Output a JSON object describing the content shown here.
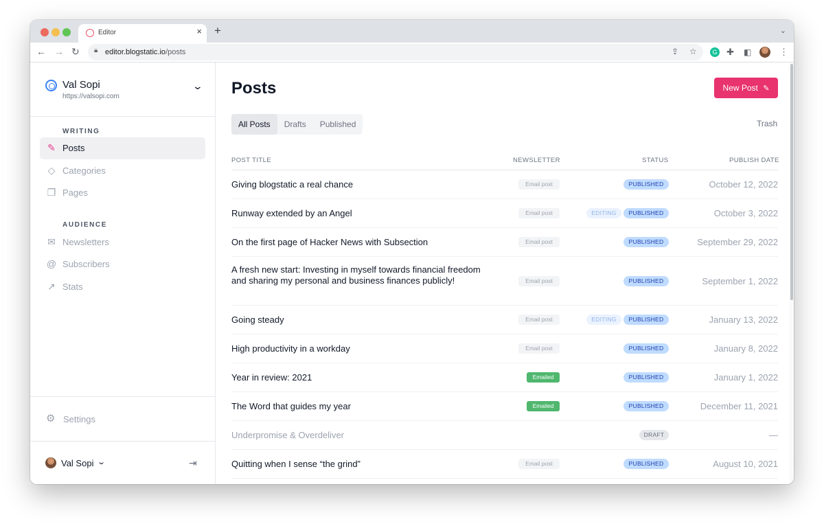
{
  "browser": {
    "tab_title": "Editor",
    "url_domain": "editor.blogstatic.io",
    "url_path": "/posts"
  },
  "site": {
    "name": "Val Sopi",
    "url": "https://valsopi.com"
  },
  "sidebar": {
    "writing_heading": "WRITING",
    "writing_items": [
      {
        "label": "Posts",
        "icon": "edit-icon",
        "active": true
      },
      {
        "label": "Categories",
        "icon": "tag-icon",
        "active": false
      },
      {
        "label": "Pages",
        "icon": "pages-icon",
        "active": false
      }
    ],
    "audience_heading": "AUDIENCE",
    "audience_items": [
      {
        "label": "Newsletters",
        "icon": "mail-icon"
      },
      {
        "label": "Subscribers",
        "icon": "at-icon"
      },
      {
        "label": "Stats",
        "icon": "trend-icon"
      }
    ],
    "settings_label": "Settings",
    "user_name": "Val Sopi"
  },
  "main": {
    "title": "Posts",
    "new_post_label": "New Post",
    "filters": [
      "All Posts",
      "Drafts",
      "Published"
    ],
    "active_filter": "All Posts",
    "trash_label": "Trash",
    "columns": [
      "POST TITLE",
      "NEWSLETTER",
      "STATUS",
      "PUBLISH DATE"
    ],
    "posts": [
      {
        "title": "Giving blogstatic a real chance",
        "newsletter": "Email post",
        "editing": "",
        "status": "PUBLISHED",
        "date": "October 12, 2022"
      },
      {
        "title": "Runway extended by an Angel",
        "newsletter": "Email post",
        "editing": "EDITING",
        "status": "PUBLISHED",
        "date": "October 3, 2022"
      },
      {
        "title": "On the first page of Hacker News with Subsection",
        "newsletter": "Email post",
        "editing": "",
        "status": "PUBLISHED",
        "date": "September 29, 2022"
      },
      {
        "title": "A fresh new start: Investing in myself towards financial freedom and sharing my personal and business finances publicly!",
        "newsletter": "Email post",
        "editing": "",
        "status": "PUBLISHED",
        "date": "September 1, 2022"
      },
      {
        "title": "Going steady",
        "newsletter": "Email post",
        "editing": "EDITING",
        "status": "PUBLISHED",
        "date": "January 13, 2022"
      },
      {
        "title": "High productivity in a workday",
        "newsletter": "Email post",
        "editing": "",
        "status": "PUBLISHED",
        "date": "January 8, 2022"
      },
      {
        "title": "Year in review: 2021",
        "newsletter": "Emailed",
        "editing": "",
        "status": "PUBLISHED",
        "date": "January 1, 2022"
      },
      {
        "title": "The Word that guides my year",
        "newsletter": "Emailed",
        "editing": "",
        "status": "PUBLISHED",
        "date": "December 11, 2021"
      },
      {
        "title": "Underpromise & Overdeliver",
        "newsletter": "",
        "editing": "",
        "status": "DRAFT",
        "date": "—"
      },
      {
        "title": "Quitting when I sense “the grind”",
        "newsletter": "Email post",
        "editing": "",
        "status": "PUBLISHED",
        "date": "August 10, 2021"
      }
    ]
  }
}
